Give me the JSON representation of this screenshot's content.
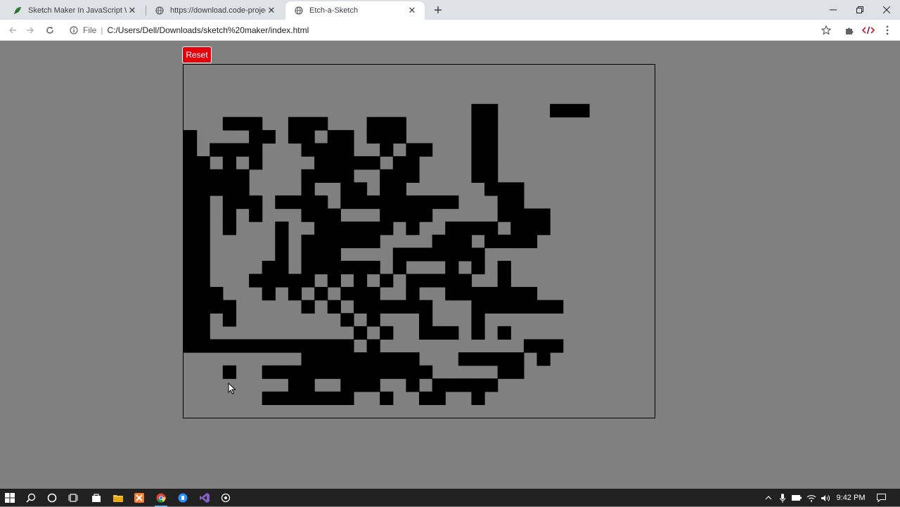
{
  "tabs": [
    {
      "title": "Sketch Maker In JavaScript With",
      "active": false
    },
    {
      "title": "https://download.code-projects.o",
      "active": false
    },
    {
      "title": "Etch-a-Sketch",
      "active": true
    }
  ],
  "address": {
    "scheme": "File",
    "url": "C:/Users/Dell/Downloads/sketch%20maker/index.html"
  },
  "page": {
    "reset_label": "Reset",
    "grid": {
      "rows": 27,
      "cols": 36,
      "cells": [
        "....................................",
        "....................................",
        "....................................",
        "......................##....###.....",
        "...###..###...###.....##............",
        "#....##.##.##.###.....##............",
        "#.####...####..#.##...##............",
        "##.#.#....#####.##....##............",
        "#####....####..###....##............",
        "#####....#..##.##......###..........",
        "##.###.####.#########...##..........",
        "##.#.#...###...####.....####........",
        "##.#...#..######.#..####.###........",
        "##.....#.######....###.####.........",
        "##.....#.###....#######.............",
        "##....##.######.#...#.#.#...........",
        "##...#####.#.#.#.#####..#...........",
        "###...#.#.#.###..#..#######.........",
        "####.....#.#.######...#######.......",
        "##.#........#.#...#...#.............",
        "##...........#.#..###.#.#...........",
        "#############.#...........###.......",
        ".........#########...#####.#........",
        "...#..#############.....##..........",
        "........##..###..#.#####............",
        "......#######..#..##..#.............",
        "...................................."
      ]
    }
  },
  "taskbar": {
    "clock": "9:42 PM"
  },
  "colors": {
    "background": "#808080",
    "reset": "#e3000b",
    "ink": "#000000"
  }
}
